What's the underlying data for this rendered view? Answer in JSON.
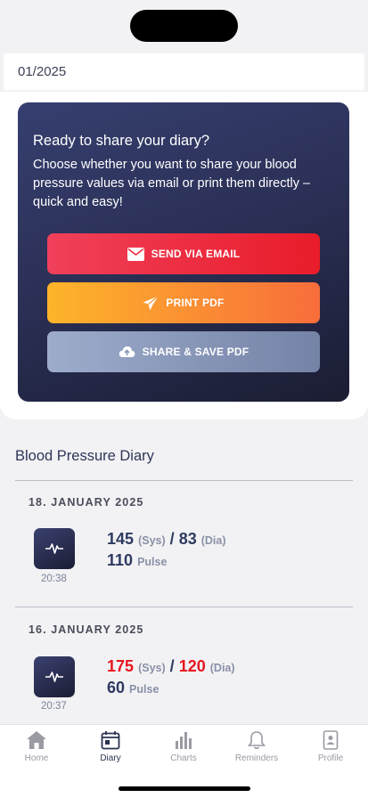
{
  "month": "01/2025",
  "share": {
    "title": "Ready to share your diary?",
    "text": "Choose whether you want to share your blood pressure values via email or print them directly – quick and easy!",
    "email_label": "SEND VIA EMAIL",
    "print_label": "PRINT PDF",
    "share_label": "SHARE & SAVE PDF"
  },
  "diary": {
    "title": "Blood Pressure Diary",
    "entries": [
      {
        "date": "18. JANUARY 2025",
        "time": "20:38",
        "sys": "145",
        "dia": "83",
        "pulse": "110",
        "sys_unit": "(Sys)",
        "dia_unit": "(Dia)",
        "pulse_unit": "Pulse"
      },
      {
        "date": "16. JANUARY 2025",
        "time": "20:37",
        "sys": "175",
        "dia": "120",
        "pulse": "60",
        "sys_unit": "(Sys)",
        "dia_unit": "(Dia)",
        "pulse_unit": "Pulse"
      }
    ]
  },
  "tabs": [
    {
      "label": "Home",
      "icon": "home-icon"
    },
    {
      "label": "Diary",
      "icon": "diary-icon",
      "active": true
    },
    {
      "label": "Charts",
      "icon": "charts-icon"
    },
    {
      "label": "Reminders",
      "icon": "bell-icon"
    },
    {
      "label": "Profile",
      "icon": "profile-icon"
    }
  ],
  "colors": {
    "accent_dark": "#2b3350",
    "email_red": "#e91c2a",
    "print_orange": "#f86d3b",
    "share_gray": "#7483a6",
    "high_value_red": "#e8141e"
  }
}
